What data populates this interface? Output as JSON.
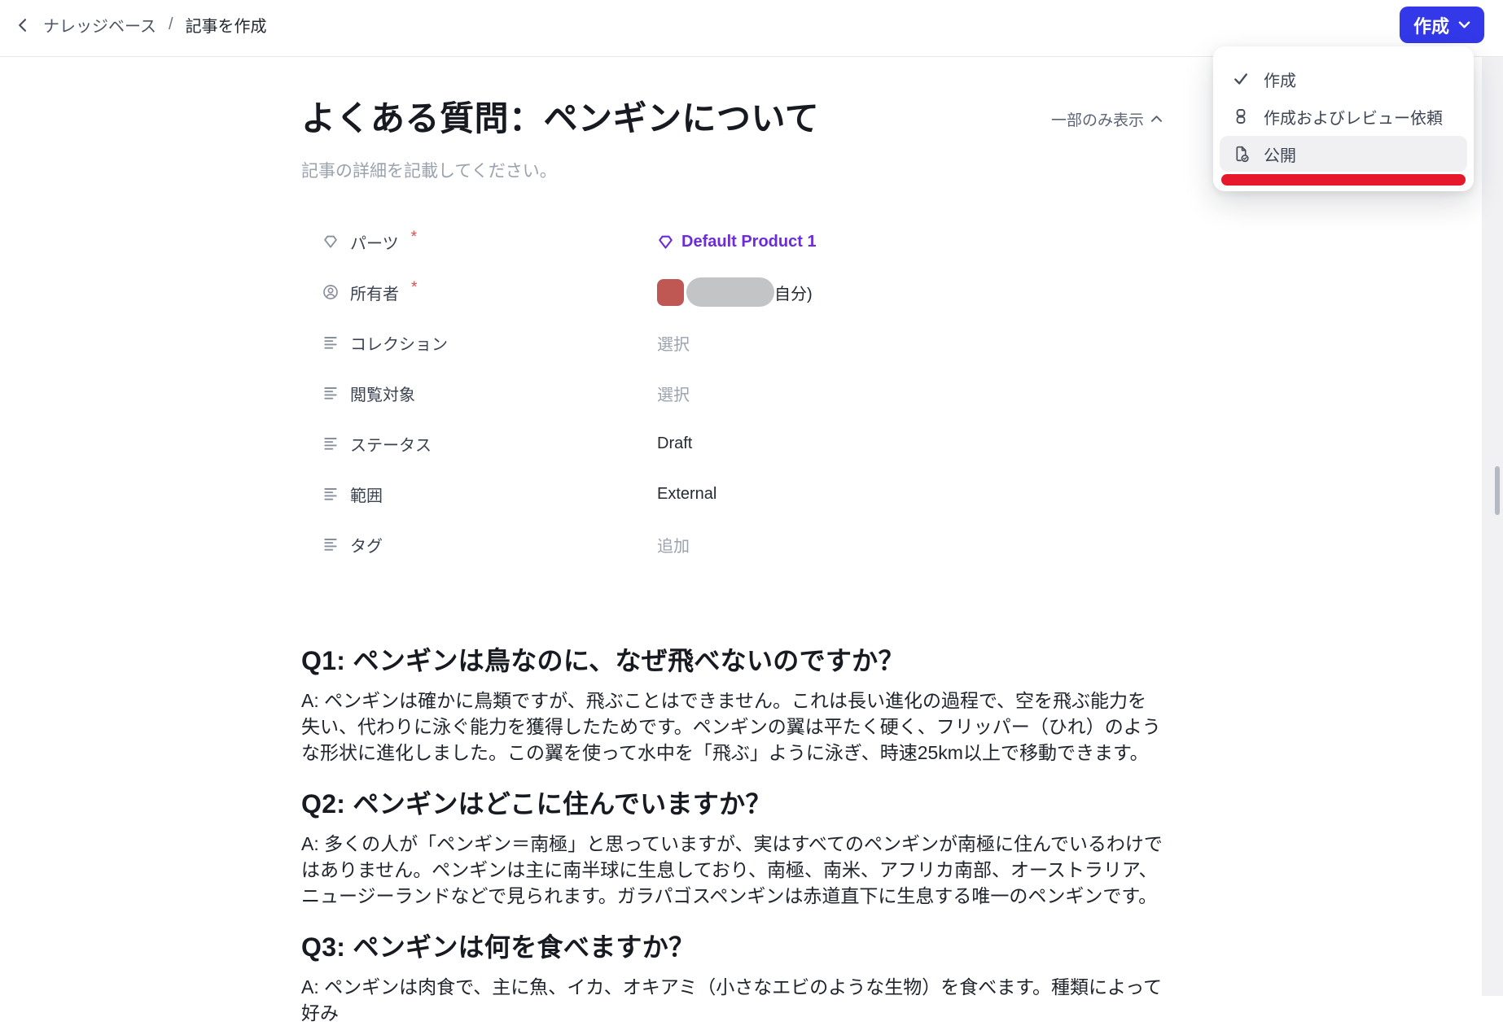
{
  "header": {
    "breadcrumb": {
      "back_icon": "chevron-left-icon",
      "section": "ナレッジベース",
      "separator": "/",
      "current": "記事を作成"
    },
    "create_button": {
      "label": "作成",
      "icon": "chevron-down-icon",
      "color": "#3338e9"
    }
  },
  "create_menu": {
    "items": [
      {
        "label": "作成",
        "icon": "check-icon",
        "selected": true
      },
      {
        "label": "作成およびレビュー依頼",
        "icon": "hourglass-icon",
        "selected": false
      },
      {
        "label": "公開",
        "icon": "document-check-icon",
        "selected": false,
        "highlighted": true
      }
    ],
    "annotation_color": "#e6182b"
  },
  "article": {
    "title": "よくある質問：ペンギンについて",
    "visibility_toggle": {
      "label": "一部のみ表示",
      "icon": "chevron-up-icon"
    },
    "description_placeholder": "記事の詳細を記載してください。",
    "required_marker": "*",
    "fields": [
      {
        "label": "パーツ",
        "icon": "gem-icon",
        "required": true,
        "value": "Default Product 1",
        "value_color": "#6d2bd9"
      },
      {
        "label": "所有者",
        "icon": "user-circle-icon",
        "required": true,
        "value_suffix": "自分)",
        "avatar_color": "#bf5753"
      },
      {
        "label": "コレクション",
        "icon": "list-icon",
        "value": "選択",
        "is_placeholder": true
      },
      {
        "label": "閲覧対象",
        "icon": "list-icon",
        "value": "選択",
        "is_placeholder": true
      },
      {
        "label": "ステータス",
        "icon": "list-icon",
        "value": "Draft",
        "is_placeholder": false
      },
      {
        "label": "範囲",
        "icon": "list-icon",
        "value": "External",
        "is_placeholder": false
      },
      {
        "label": "タグ",
        "icon": "list-icon",
        "value": "追加",
        "is_placeholder": true
      }
    ],
    "qa": [
      {
        "question": "Q1: ペンギンは鳥なのに、なぜ飛べないのですか？",
        "answer": "A: ペンギンは確かに鳥類ですが、飛ぶことはできません。これは長い進化の過程で、空を飛ぶ能力を失い、代わりに泳ぐ能力を獲得したためです。ペンギンの翼は平たく硬く、フリッパー（ひれ）のような形状に進化しました。この翼を使って水中を「飛ぶ」ように泳ぎ、時速25km以上で移動できます。"
      },
      {
        "question": "Q2: ペンギンはどこに住んでいますか？",
        "answer": "A: 多くの人が「ペンギン＝南極」と思っていますが、実はすべてのペンギンが南極に住んでいるわけではありません。ペンギンは主に南半球に生息しており、南極、南米、アフリカ南部、オーストラリア、ニュージーランドなどで見られます。ガラパゴスペンギンは赤道直下に生息する唯一のペンギンです。"
      },
      {
        "question": "Q3: ペンギンは何を食べますか？",
        "answer": "A: ペンギンは肉食で、主に魚、イカ、オキアミ（小さなエビのような生物）を食べます。種類によって好み"
      }
    ]
  }
}
